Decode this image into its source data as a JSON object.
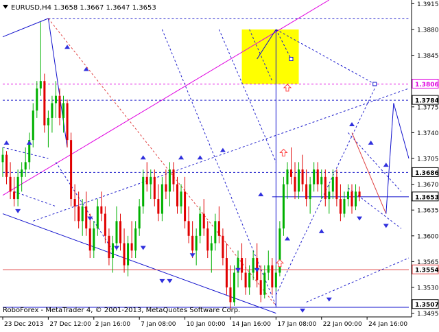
{
  "window": {
    "symbol_header": "EURUSD,H4  1.3658 1.3667 1.3647 1.3653",
    "watermark": "RoboForex - MetaTrader 4, © 2001-2013, MetaQuotes Software Corp."
  },
  "colors": {
    "background": "#ffffff",
    "bull_candle": "#00b000",
    "bear_candle": "#e00000",
    "trend_blue": "#1010cc",
    "dashed_blue": "#2020cc",
    "magenta": "#e000e0",
    "red_dash": "#e04040",
    "highlight": "#ffff00",
    "arrow_up": "#ff4444",
    "fractal": "#3030dd"
  },
  "chart_data": {
    "type": "candlestick",
    "symbol": "EURUSD",
    "timeframe": "H4",
    "ohlc_last": {
      "open": 1.3658,
      "high": 1.3667,
      "low": 1.3647,
      "close": 1.3653
    },
    "ylim": [
      1.349,
      1.392
    ],
    "xlim": [
      0,
      107
    ],
    "y_ticks": [
      1.3495,
      1.353,
      1.3565,
      1.36,
      1.3635,
      1.367,
      1.3705,
      1.374,
      1.3775,
      1.381,
      1.3845,
      1.388,
      1.3915
    ],
    "x_ticks": [
      {
        "i": 0,
        "label": "23 Dec 2013"
      },
      {
        "i": 12,
        "label": "27 Dec 12:00"
      },
      {
        "i": 24,
        "label": "2 Jan 16:00"
      },
      {
        "i": 36,
        "label": "7 Jan 08:00"
      },
      {
        "i": 48,
        "label": "10 Jan 00:00"
      },
      {
        "i": 60,
        "label": "14 Jan 16:00"
      },
      {
        "i": 72,
        "label": "17 Jan 08:00"
      },
      {
        "i": 84,
        "label": "22 Jan 00:00"
      },
      {
        "i": 96,
        "label": "24 Jan 16:00"
      }
    ],
    "price_labels": [
      {
        "value": 1.3806,
        "label": "1.3806",
        "kind": "magenta_level"
      },
      {
        "value": 1.3784,
        "label": "1.3784",
        "kind": "level"
      },
      {
        "value": 1.3686,
        "label": "1.3686",
        "kind": "level"
      },
      {
        "value": 1.3653,
        "label": "1.3653",
        "kind": "current"
      },
      {
        "value": 1.3554,
        "label": "1.3554",
        "kind": "red_level"
      },
      {
        "value": 1.3507,
        "label": "1.3507",
        "kind": "level"
      }
    ],
    "candles": [
      [
        1.37,
        1.372,
        1.368,
        1.371
      ],
      [
        1.371,
        1.3715,
        1.367,
        1.368
      ],
      [
        1.368,
        1.37,
        1.365,
        1.366
      ],
      [
        1.366,
        1.368,
        1.364,
        1.365
      ],
      [
        1.365,
        1.369,
        1.364,
        1.368
      ],
      [
        1.368,
        1.37,
        1.366,
        1.369
      ],
      [
        1.369,
        1.372,
        1.368,
        1.37
      ],
      [
        1.37,
        1.374,
        1.369,
        1.373
      ],
      [
        1.373,
        1.378,
        1.372,
        1.377
      ],
      [
        1.377,
        1.381,
        1.376,
        1.38
      ],
      [
        1.38,
        1.389,
        1.379,
        1.381
      ],
      [
        1.381,
        1.382,
        1.374,
        1.375
      ],
      [
        1.375,
        1.377,
        1.372,
        1.376
      ],
      [
        1.376,
        1.379,
        1.374,
        1.378
      ],
      [
        1.378,
        1.381,
        1.376,
        1.379
      ],
      [
        1.379,
        1.38,
        1.375,
        1.376
      ],
      [
        1.376,
        1.379,
        1.374,
        1.378
      ],
      [
        1.378,
        1.3785,
        1.372,
        1.373
      ],
      [
        1.373,
        1.374,
        1.364,
        1.365
      ],
      [
        1.365,
        1.367,
        1.362,
        1.364
      ],
      [
        1.364,
        1.366,
        1.361,
        1.362
      ],
      [
        1.362,
        1.365,
        1.36,
        1.364
      ],
      [
        1.364,
        1.366,
        1.36,
        1.361
      ],
      [
        1.361,
        1.363,
        1.357,
        1.358
      ],
      [
        1.358,
        1.362,
        1.357,
        1.361
      ],
      [
        1.361,
        1.365,
        1.36,
        1.364
      ],
      [
        1.364,
        1.366,
        1.362,
        1.363
      ],
      [
        1.363,
        1.364,
        1.359,
        1.36
      ],
      [
        1.36,
        1.361,
        1.356,
        1.357
      ],
      [
        1.357,
        1.36,
        1.355,
        1.359
      ],
      [
        1.359,
        1.364,
        1.358,
        1.362
      ],
      [
        1.362,
        1.363,
        1.358,
        1.359
      ],
      [
        1.359,
        1.361,
        1.355,
        1.356
      ],
      [
        1.356,
        1.36,
        1.3545,
        1.359
      ],
      [
        1.359,
        1.362,
        1.357,
        1.358
      ],
      [
        1.358,
        1.362,
        1.357,
        1.361
      ],
      [
        1.361,
        1.365,
        1.36,
        1.364
      ],
      [
        1.364,
        1.369,
        1.363,
        1.368
      ],
      [
        1.368,
        1.37,
        1.366,
        1.367
      ],
      [
        1.367,
        1.369,
        1.365,
        1.368
      ],
      [
        1.368,
        1.369,
        1.364,
        1.365
      ],
      [
        1.365,
        1.367,
        1.362,
        1.363
      ],
      [
        1.363,
        1.368,
        1.362,
        1.367
      ],
      [
        1.367,
        1.369,
        1.365,
        1.366
      ],
      [
        1.366,
        1.37,
        1.364,
        1.369
      ],
      [
        1.369,
        1.37,
        1.366,
        1.367
      ],
      [
        1.367,
        1.368,
        1.363,
        1.364
      ],
      [
        1.364,
        1.367,
        1.363,
        1.366
      ],
      [
        1.366,
        1.368,
        1.361,
        1.362
      ],
      [
        1.362,
        1.364,
        1.359,
        1.36
      ],
      [
        1.36,
        1.362,
        1.357,
        1.358
      ],
      [
        1.358,
        1.361,
        1.356,
        1.36
      ],
      [
        1.36,
        1.364,
        1.359,
        1.363
      ],
      [
        1.363,
        1.365,
        1.36,
        1.361
      ],
      [
        1.361,
        1.362,
        1.357,
        1.358
      ],
      [
        1.358,
        1.36,
        1.355,
        1.359
      ],
      [
        1.359,
        1.363,
        1.358,
        1.362
      ],
      [
        1.362,
        1.364,
        1.359,
        1.36
      ],
      [
        1.36,
        1.361,
        1.356,
        1.357
      ],
      [
        1.357,
        1.359,
        1.352,
        1.353
      ],
      [
        1.353,
        1.356,
        1.35,
        1.351
      ],
      [
        1.351,
        1.356,
        1.3505,
        1.355
      ],
      [
        1.355,
        1.358,
        1.353,
        1.357
      ],
      [
        1.357,
        1.359,
        1.354,
        1.355
      ],
      [
        1.355,
        1.357,
        1.352,
        1.353
      ],
      [
        1.353,
        1.356,
        1.352,
        1.355
      ],
      [
        1.355,
        1.358,
        1.354,
        1.357
      ],
      [
        1.357,
        1.359,
        1.353,
        1.354
      ],
      [
        1.354,
        1.356,
        1.351,
        1.352
      ],
      [
        1.352,
        1.356,
        1.3515,
        1.355
      ],
      [
        1.355,
        1.358,
        1.354,
        1.356
      ],
      [
        1.356,
        1.357,
        1.352,
        1.353
      ],
      [
        1.353,
        1.356,
        1.3525,
        1.355
      ],
      [
        1.355,
        1.362,
        1.3545,
        1.361
      ],
      [
        1.361,
        1.368,
        1.36,
        1.367
      ],
      [
        1.367,
        1.37,
        1.365,
        1.369
      ],
      [
        1.369,
        1.372,
        1.367,
        1.368
      ],
      [
        1.368,
        1.37,
        1.365,
        1.366
      ],
      [
        1.366,
        1.37,
        1.365,
        1.369
      ],
      [
        1.369,
        1.371,
        1.366,
        1.367
      ],
      [
        1.367,
        1.369,
        1.364,
        1.365
      ],
      [
        1.365,
        1.368,
        1.363,
        1.367
      ],
      [
        1.367,
        1.37,
        1.366,
        1.369
      ],
      [
        1.369,
        1.37,
        1.366,
        1.367
      ],
      [
        1.367,
        1.369,
        1.365,
        1.368
      ],
      [
        1.368,
        1.369,
        1.364,
        1.365
      ],
      [
        1.365,
        1.367,
        1.363,
        1.366
      ],
      [
        1.366,
        1.369,
        1.365,
        1.368
      ],
      [
        1.368,
        1.369,
        1.364,
        1.365
      ],
      [
        1.365,
        1.367,
        1.362,
        1.363
      ],
      [
        1.363,
        1.366,
        1.3625,
        1.365
      ],
      [
        1.365,
        1.367,
        1.364,
        1.366
      ],
      [
        1.366,
        1.367,
        1.363,
        1.364
      ],
      [
        1.364,
        1.367,
        1.3635,
        1.366
      ],
      [
        1.366,
        1.3667,
        1.3647,
        1.3653
      ]
    ],
    "drawn_lines": [
      {
        "style": "solid",
        "color": "trend_blue",
        "from": [
          0,
          1.387
        ],
        "to": [
          12,
          1.3895
        ]
      },
      {
        "style": "solid",
        "color": "trend_blue",
        "from": [
          12,
          1.3895
        ],
        "to": [
          17,
          1.372
        ]
      },
      {
        "style": "solid",
        "color": "trend_blue",
        "from": [
          0,
          1.363
        ],
        "to": [
          72,
          1.3495
        ]
      },
      {
        "style": "solid",
        "color": "magenta",
        "from": [
          0,
          1.3655
        ],
        "to": [
          86,
          1.392
        ]
      },
      {
        "style": "dashed",
        "color": "dashed_blue",
        "from": [
          12,
          1.3895
        ],
        "to": [
          107,
          1.3895
        ]
      },
      {
        "style": "dashed",
        "color": "magenta",
        "from": [
          0,
          1.3806
        ],
        "to": [
          107,
          1.3806
        ]
      },
      {
        "style": "dashed",
        "color": "dashed_blue",
        "from": [
          0,
          1.3784
        ],
        "to": [
          107,
          1.3784
        ]
      },
      {
        "style": "dashed",
        "color": "dashed_blue",
        "from": [
          0,
          1.3686
        ],
        "to": [
          107,
          1.3686
        ]
      },
      {
        "style": "solid",
        "color": "trend_blue",
        "from": [
          71,
          1.3653
        ],
        "to": [
          107,
          1.3653
        ]
      },
      {
        "style": "solid",
        "color": "red_dash",
        "from": [
          0,
          1.3554
        ],
        "to": [
          107,
          1.3554
        ]
      },
      {
        "style": "solid",
        "color": "trend_blue",
        "from": [
          0,
          1.3503
        ],
        "to": [
          107,
          1.3503
        ]
      },
      {
        "style": "dashed",
        "color": "red_dash",
        "from": [
          12,
          1.3895
        ],
        "to": [
          72,
          1.3505
        ]
      },
      {
        "style": "dashed",
        "color": "dashed_blue",
        "from": [
          0,
          1.372
        ],
        "to": [
          12,
          1.3705
        ]
      },
      {
        "style": "dashed",
        "color": "dashed_blue",
        "from": [
          3,
          1.366
        ],
        "to": [
          14,
          1.364
        ]
      },
      {
        "style": "dashed",
        "color": "dashed_blue",
        "from": [
          8,
          1.362
        ],
        "to": [
          107,
          1.38
        ]
      },
      {
        "style": "dashed",
        "color": "dashed_blue",
        "from": [
          42,
          1.388
        ],
        "to": [
          72,
          1.3505
        ]
      },
      {
        "style": "dashed",
        "color": "dashed_blue",
        "from": [
          57,
          1.388
        ],
        "to": [
          72,
          1.37
        ]
      },
      {
        "style": "dashed",
        "color": "dashed_blue",
        "from": [
          72,
          1.352
        ],
        "to": [
          98,
          1.38
        ]
      },
      {
        "style": "dashed",
        "color": "dashed_blue",
        "from": [
          80,
          1.351
        ],
        "to": [
          107,
          1.357
        ]
      },
      {
        "style": "dashed",
        "color": "dashed_blue",
        "from": [
          65,
          1.388
        ],
        "to": [
          71,
          1.381
        ]
      },
      {
        "style": "dashed",
        "color": "dashed_blue",
        "from": [
          14,
          1.37
        ],
        "to": [
          29,
          1.358
        ]
      },
      {
        "style": "dashed",
        "color": "dashed_blue",
        "from": [
          91,
          1.374
        ],
        "to": [
          105,
          1.366
        ]
      },
      {
        "style": "dashed",
        "color": "dashed_blue",
        "from": [
          91,
          1.3665
        ],
        "to": [
          105,
          1.361
        ]
      },
      {
        "style": "solid",
        "color": "trend_blue",
        "from": [
          72,
          1.3503
        ],
        "to": [
          72,
          1.388
        ]
      },
      {
        "style": "solid",
        "color": "trend_blue",
        "from": [
          67,
          1.384
        ],
        "to": [
          72,
          1.388
        ]
      },
      {
        "style": "dashed",
        "color": "trend_blue",
        "from": [
          72,
          1.388
        ],
        "to": [
          76,
          1.384
        ]
      },
      {
        "style": "dashed",
        "color": "trend_blue",
        "from": [
          72,
          1.388
        ],
        "to": [
          98,
          1.3806
        ]
      },
      {
        "style": "solid",
        "color": "red_dash",
        "from": [
          92,
          1.374
        ],
        "to": [
          101,
          1.363
        ]
      },
      {
        "style": "solid",
        "color": "trend_blue",
        "from": [
          101,
          1.363
        ],
        "to": [
          103,
          1.378
        ]
      },
      {
        "style": "solid",
        "color": "trend_blue",
        "from": [
          103,
          1.378
        ],
        "to": [
          107,
          1.3705
        ]
      }
    ],
    "highlight_box": {
      "from": [
        63,
        1.388
      ],
      "to": [
        78,
        1.3806
      ]
    },
    "markers": [
      {
        "kind": "arrow_up_outline",
        "at": [
          75,
          1.38
        ]
      },
      {
        "kind": "arrow_up_outline",
        "at": [
          74,
          1.3712
        ]
      },
      {
        "kind": "arrow_up_outline",
        "at": [
          73,
          1.3562
        ]
      }
    ],
    "fractals_up": [
      [
        1,
        1.372
      ],
      [
        7,
        1.372
      ],
      [
        17,
        1.385
      ],
      [
        22,
        1.382
      ],
      [
        37,
        1.37
      ],
      [
        47,
        1.37
      ],
      [
        52,
        1.37
      ],
      [
        58,
        1.371
      ],
      [
        68,
        1.365
      ],
      [
        75,
        1.359
      ],
      [
        84,
        1.36
      ],
      [
        92,
        1.3745
      ],
      [
        97,
        1.372
      ],
      [
        101,
        1.369
      ]
    ],
    "fractals_down": [
      [
        4,
        1.364
      ],
      [
        23,
        1.363
      ],
      [
        30,
        1.359
      ],
      [
        37,
        1.359
      ],
      [
        42,
        1.3545
      ],
      [
        44,
        1.3545
      ],
      [
        50,
        1.358
      ],
      [
        62,
        1.356
      ],
      [
        67,
        1.356
      ],
      [
        79,
        1.3505
      ],
      [
        86,
        1.352
      ],
      [
        94,
        1.363
      ],
      [
        101,
        1.362
      ]
    ]
  }
}
